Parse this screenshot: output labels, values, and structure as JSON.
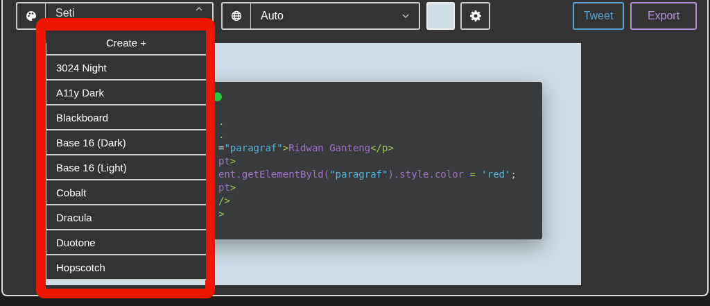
{
  "toolbar": {
    "theme_select": {
      "value": "Seti",
      "expanded": true
    },
    "language_select": {
      "value": "Auto",
      "expanded": false
    },
    "buttons": [
      {
        "label": "Tweet",
        "kind": "tweet"
      },
      {
        "label": "Export",
        "kind": "export"
      }
    ]
  },
  "theme_menu": {
    "items": [
      {
        "label": "Create +",
        "kind": "create"
      },
      {
        "label": "3024 Night",
        "kind": "theme"
      },
      {
        "label": "A11y Dark",
        "kind": "theme"
      },
      {
        "label": "Blackboard",
        "kind": "theme"
      },
      {
        "label": "Base 16 (Dark)",
        "kind": "theme"
      },
      {
        "label": "Base 16 (Light)",
        "kind": "theme"
      },
      {
        "label": "Cobalt",
        "kind": "theme"
      },
      {
        "label": "Dracula",
        "kind": "theme"
      },
      {
        "label": "Duotone",
        "kind": "theme"
      },
      {
        "label": "Hopscotch",
        "kind": "theme"
      }
    ]
  },
  "code_window": {
    "lines": [
      [
        {
          "text": ".",
          "kind": "tag"
        }
      ],
      [
        {
          "text": ".",
          "kind": "tag"
        }
      ],
      [
        {
          "text": "=",
          "kind": "plain"
        },
        {
          "text": "\"paragraf\"",
          "kind": "string"
        },
        {
          "text": ">",
          "kind": "tag"
        },
        {
          "text": "Ridwan Ganteng",
          "kind": "text"
        },
        {
          "text": "</p>",
          "kind": "tag"
        }
      ],
      [
        {
          "text": "pt",
          "kind": "text"
        },
        {
          "text": ">",
          "kind": "tag"
        }
      ],
      [
        {
          "text": "ent.getElementByld(",
          "kind": "text"
        },
        {
          "text": "\"paragraf\"",
          "kind": "string"
        },
        {
          "text": ").style.color ",
          "kind": "text"
        },
        {
          "text": "=",
          "kind": "tag"
        },
        {
          "text": " 'red'",
          "kind": "string"
        },
        {
          "text": ";",
          "kind": "plain"
        }
      ],
      [
        {
          "text": "pt",
          "kind": "text"
        },
        {
          "text": ">",
          "kind": "tag"
        }
      ],
      [
        {
          "text": "/>",
          "kind": "tag"
        }
      ],
      [
        {
          "text": ">",
          "kind": "tag"
        }
      ]
    ]
  }
}
